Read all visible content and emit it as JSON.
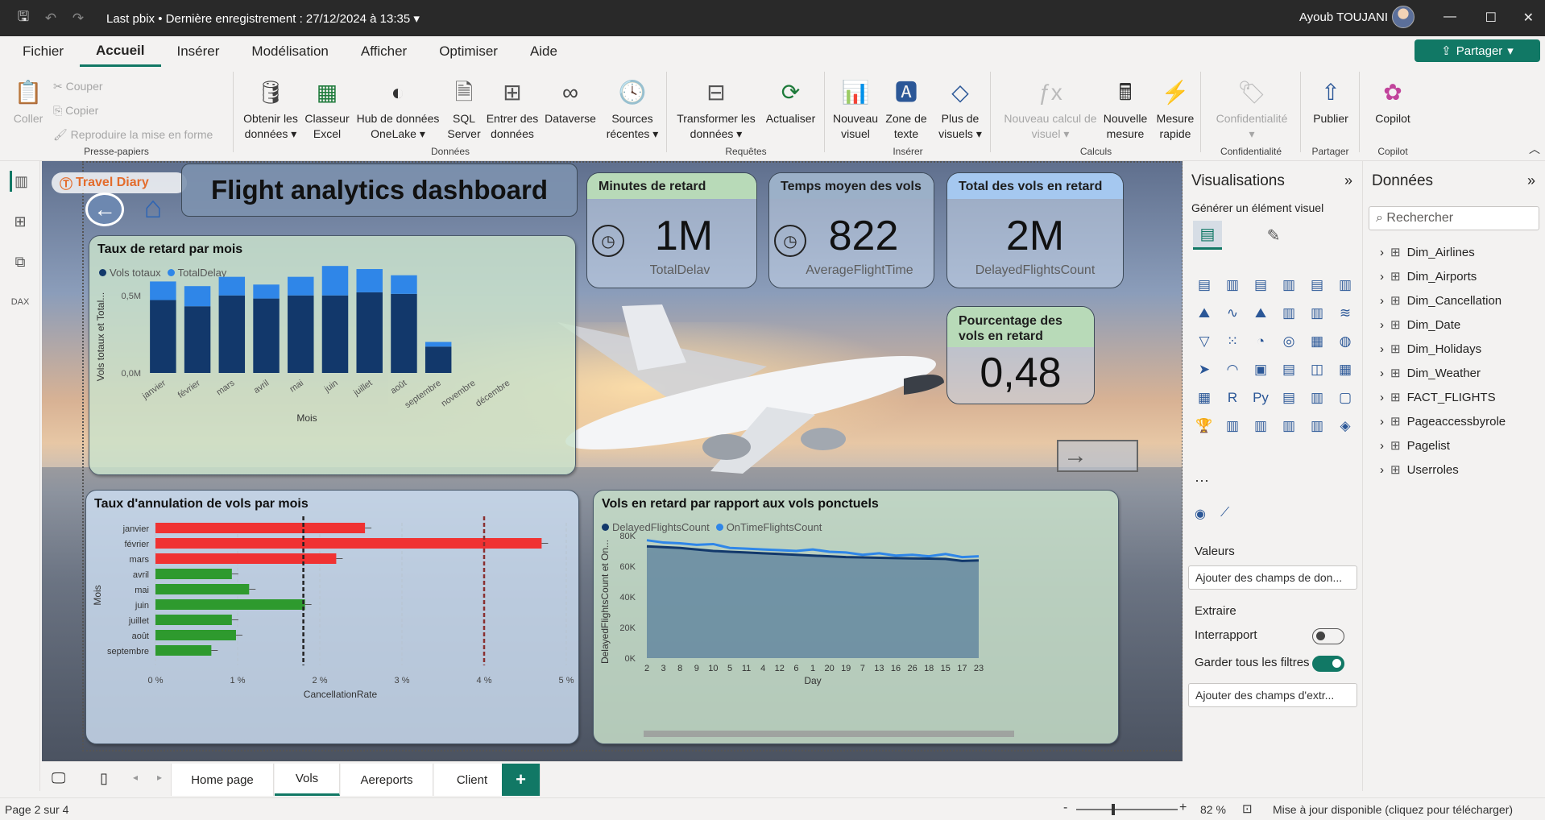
{
  "titlebar": {
    "file": "Last pbix",
    "separator": "•",
    "saved": "Dernière enregistrement : 27/12/2024 à 13:35",
    "user": "Ayoub TOUJANI"
  },
  "menu": [
    "Fichier",
    "Accueil",
    "Insérer",
    "Modélisation",
    "Afficher",
    "Optimiser",
    "Aide"
  ],
  "share_label": "Partager",
  "ribbon": {
    "clipboard": {
      "paste": "Coller",
      "cut": "Couper",
      "copy": "Copier",
      "format": "Reproduire la mise en forme",
      "group": "Presse-papiers"
    },
    "data": {
      "get": "Obtenir les données",
      "excel": "Classeur Excel",
      "hub": "Hub de données OneLake",
      "sql": "SQL Server",
      "enter": "Entrer des données",
      "dataverse": "Dataverse",
      "recent": "Sources récentes",
      "group": "Données"
    },
    "queries": {
      "transform": "Transformer les données",
      "refresh": "Actualiser",
      "group": "Requêtes"
    },
    "insert": {
      "visual": "Nouveau visuel",
      "text": "Zone de texte",
      "more": "Plus de visuels",
      "group": "Insérer"
    },
    "calc": {
      "newcalc": "Nouveau calcul de visuel",
      "measure": "Nouvelle mesure",
      "quick": "Mesure rapide",
      "group": "Calculs"
    },
    "privacy": {
      "label": "Confidentialité",
      "group": "Confidentialité"
    },
    "share": {
      "publish": "Publier",
      "group": "Partager"
    },
    "copilot": {
      "label": "Copilot",
      "group": "Copilot"
    }
  },
  "report": {
    "logo": "Travel Diary",
    "title": "Flight analytics dashboard",
    "kpis": [
      {
        "title": "Minutes de retard",
        "value": "1M",
        "sub": "TotalDelav"
      },
      {
        "title": "Temps moyen des vols",
        "value": "822",
        "sub": "AverageFlightTime"
      },
      {
        "title": "Total des vols en retard",
        "value": "2M",
        "sub": "DelayedFlightsCount"
      },
      {
        "title": "Pourcentage des vols en retard",
        "value": "0,48",
        "sub": ""
      }
    ]
  },
  "chart_data": [
    {
      "type": "bar",
      "title": "Taux de retard par mois",
      "xlabel": "Mois",
      "ylabel": "Vols totaux et Total...",
      "ylim": [
        0,
        0.8
      ],
      "yticks": [
        "0,0M",
        "0,5M"
      ],
      "categories": [
        "janvier",
        "février",
        "mars",
        "avril",
        "mai",
        "juin",
        "juillet",
        "août",
        "septembre",
        "novembre",
        "décembre"
      ],
      "series": [
        {
          "name": "Vols totaux",
          "values": [
            0.47,
            0.43,
            0.5,
            0.48,
            0.5,
            0.5,
            0.52,
            0.51,
            0.17,
            0,
            0
          ]
        },
        {
          "name": "TotalDelay",
          "values": [
            0.12,
            0.13,
            0.12,
            0.09,
            0.12,
            0.19,
            0.15,
            0.12,
            0.03,
            0,
            0
          ]
        }
      ]
    },
    {
      "type": "bar",
      "orientation": "horizontal",
      "title": "Taux d'annulation de vols par mois",
      "xlabel": "CancellationRate",
      "ylabel": "Mois",
      "xlim": [
        0,
        5
      ],
      "xticks": [
        "0 %",
        "1 %",
        "2 %",
        "3 %",
        "4 %",
        "5 %"
      ],
      "reference_lines": [
        1.8,
        4.0
      ],
      "categories": [
        "janvier",
        "février",
        "mars",
        "avril",
        "mai",
        "juin",
        "juillet",
        "août",
        "septembre"
      ],
      "values": [
        2.55,
        4.7,
        2.2,
        0.93,
        1.14,
        1.82,
        0.93,
        0.98,
        0.68
      ]
    },
    {
      "type": "area",
      "title": "Vols en retard par rapport aux vols ponctuels",
      "xlabel": "Day",
      "ylabel": "DelayedFlightsCount et On...",
      "ylim": [
        0,
        80000
      ],
      "yticks": [
        "0K",
        "20K",
        "40K",
        "60K",
        "80K"
      ],
      "categories": [
        "2",
        "3",
        "8",
        "9",
        "10",
        "5",
        "11",
        "4",
        "12",
        "6",
        "1",
        "20",
        "19",
        "7",
        "13",
        "16",
        "26",
        "18",
        "15",
        "17",
        "23"
      ],
      "series": [
        {
          "name": "DelayedFlightsCount",
          "values": [
            73000,
            72500,
            72000,
            71000,
            70000,
            69500,
            69000,
            68500,
            68000,
            67500,
            67000,
            66500,
            66000,
            65800,
            65500,
            65300,
            65100,
            65000,
            64800,
            63500,
            63800
          ]
        },
        {
          "name": "OnTimeFlightsCount",
          "values": [
            77000,
            75500,
            75000,
            74000,
            74500,
            72000,
            71500,
            71000,
            70500,
            70000,
            71000,
            69500,
            69000,
            67500,
            68500,
            67000,
            67500,
            66500,
            68000,
            66000,
            66500
          ]
        }
      ]
    }
  ],
  "viz": {
    "title": "Visualisations",
    "build": "Générer un élément visuel",
    "values": "Valeurs",
    "values_ph": "Ajouter des champs de don...",
    "drill": "Extraire",
    "cross": "Interrapport",
    "keep": "Garder tous les filtres",
    "drill_ph": "Ajouter des champs d'extr..."
  },
  "data_pane": {
    "title": "Données",
    "search": "Rechercher",
    "tables": [
      "Dim_Airlines",
      "Dim_Airports",
      "Dim_Cancellation",
      "Dim_Date",
      "Dim_Holidays",
      "Dim_Weather",
      "FACT_FLIGHTS",
      "Pageaccessbyrole",
      "Pagelist",
      "Userroles"
    ]
  },
  "tabs": [
    "Home page",
    "Vols",
    "Aereports",
    "Client"
  ],
  "status": {
    "page": "Page 2 sur 4",
    "zoom": "82 %",
    "update": "Mise à jour disponible (cliquez pour télécharger)"
  },
  "colors": {
    "accent": "#117865",
    "series_dark": "#12386b",
    "series_light": "#2f86e8",
    "bar_red": "#f03232",
    "bar_green": "#2e9a2e"
  }
}
